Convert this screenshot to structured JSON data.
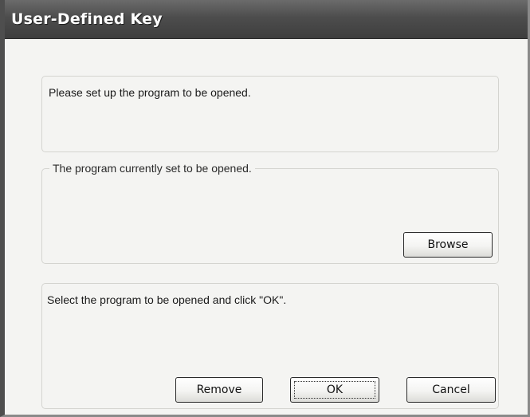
{
  "window": {
    "title": "User-Defined Key"
  },
  "setup_panel": {
    "message": "Please set up the program to be opened."
  },
  "current_program": {
    "caption": "The program currently set to be opened.",
    "value": "",
    "browse_label": "Browse"
  },
  "select_panel": {
    "message": "Select the program to be opened and click \"OK\".",
    "remove_label": "Remove",
    "ok_label": "OK",
    "cancel_label": "Cancel"
  },
  "colors": {
    "title_bar": "#4d4d4d",
    "client_background": "#f4f4f2",
    "title_text": "#ffffff"
  }
}
